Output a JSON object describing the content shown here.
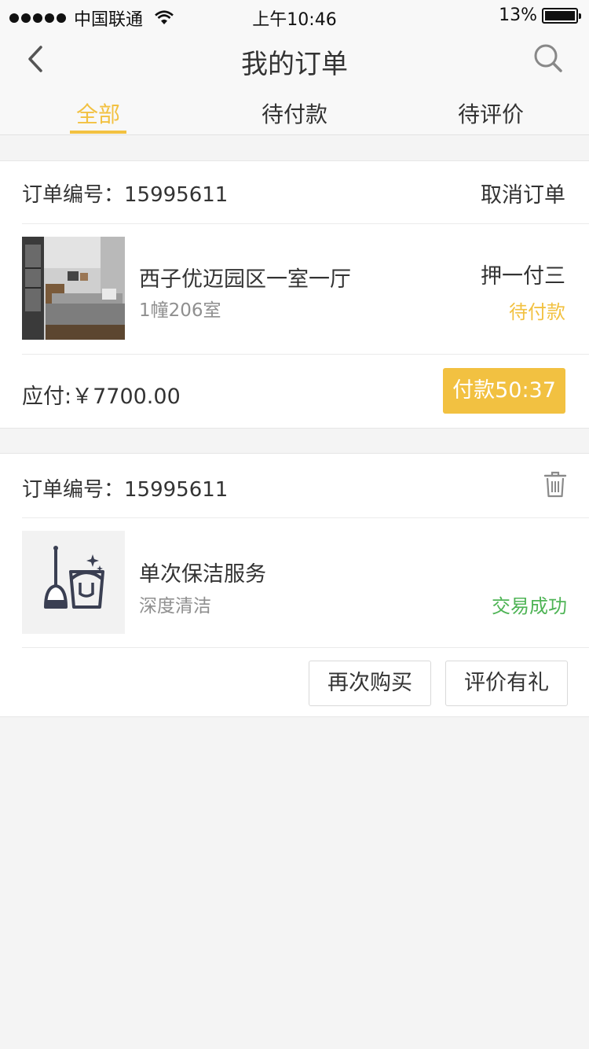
{
  "status_bar": {
    "carrier": "中国联通",
    "time": "上午10:46",
    "battery": "13%"
  },
  "nav": {
    "title": "我的订单",
    "back_icon": "chevron-left-icon",
    "search_icon": "search-icon"
  },
  "tabs": [
    {
      "label": "全部",
      "active": true
    },
    {
      "label": "待付款",
      "active": false
    },
    {
      "label": "待评价",
      "active": false
    }
  ],
  "orders": [
    {
      "order_label": "订单编号：15995611",
      "action_label": "取消订单",
      "item_title": "西子优迈园区一室一厅",
      "item_sub": "1幢206室",
      "plan": "押一付三",
      "status": "待付款",
      "amount": "应付:￥7700.00",
      "pay_button": "付款50:37"
    },
    {
      "order_label": "订单编号：15995611",
      "action_icon": "trash-icon",
      "item_title": "单次保洁服务",
      "item_sub": "深度清洁",
      "status": "交易成功",
      "buttons": [
        "再次购买",
        "评价有礼"
      ]
    }
  ],
  "colors": {
    "accent": "#f2c141",
    "success": "#4fb456",
    "background": "#f4f4f4"
  }
}
